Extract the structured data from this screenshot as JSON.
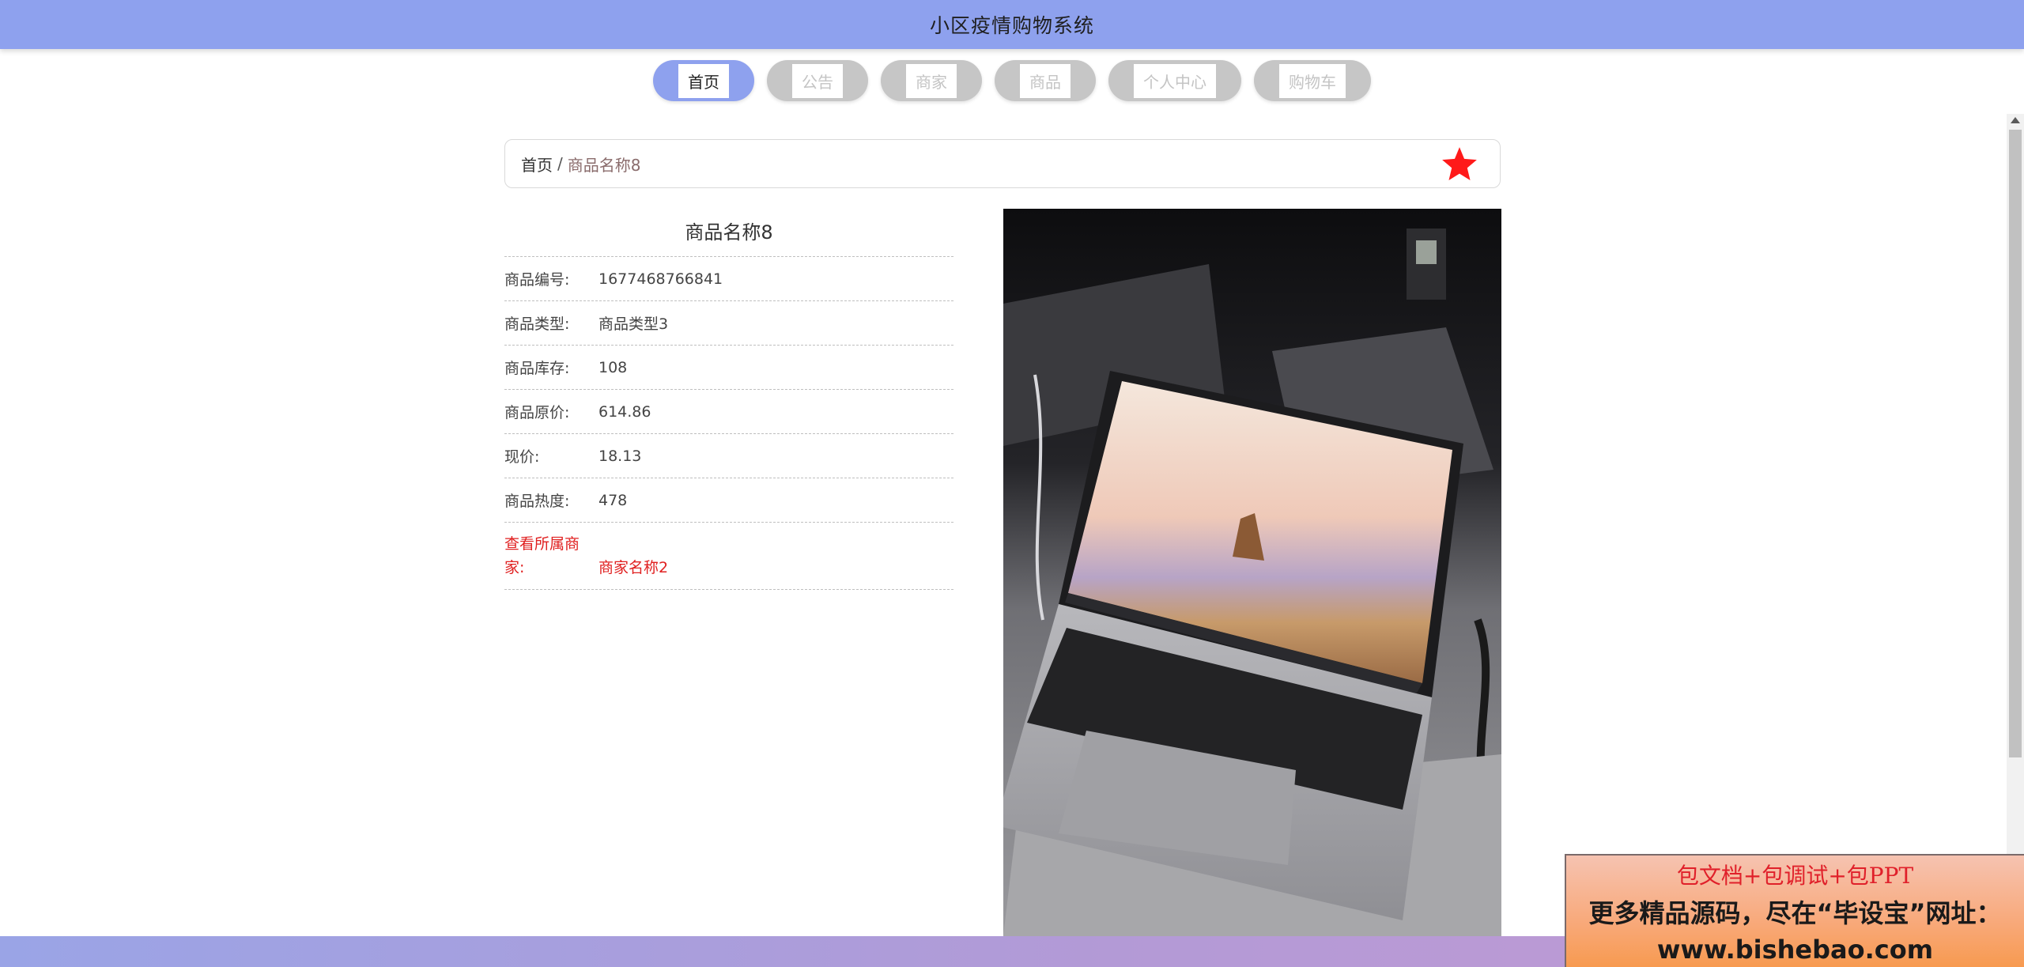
{
  "header": {
    "title": "小区疫情购物系统"
  },
  "nav": {
    "items": [
      {
        "label": "首页",
        "active": true
      },
      {
        "label": "公告",
        "active": false
      },
      {
        "label": "商家",
        "active": false
      },
      {
        "label": "商品",
        "active": false
      },
      {
        "label": "个人中心",
        "active": false
      },
      {
        "label": "购物车",
        "active": false
      }
    ]
  },
  "breadcrumb": {
    "home": "首页",
    "separator": "/",
    "current": "商品名称8",
    "favorite_icon": "star-icon"
  },
  "product": {
    "title": "商品名称8",
    "rows": [
      {
        "key": "商品编号:",
        "value": "1677468766841"
      },
      {
        "key": "商品类型:",
        "value": "商品类型3"
      },
      {
        "key": "商品库存:",
        "value": "108"
      },
      {
        "key": "商品原价:",
        "value": "614.86"
      },
      {
        "key": "现价:",
        "value": "18.13"
      },
      {
        "key": "商品热度:",
        "value": "478"
      }
    ],
    "merchant_link_label": "查看所属商家:",
    "merchant_name": "商家名称2"
  },
  "promo": {
    "line1": "包文档+包调试+包PPT",
    "line2": "更多精品源码，尽在“毕设宝”网址：",
    "line3": "www.bishebao.com"
  },
  "colors": {
    "header": "#8ea1ee",
    "nav_inactive": "#c6c6c6",
    "favorite": "#ff1a1a",
    "link": "#e02020"
  }
}
